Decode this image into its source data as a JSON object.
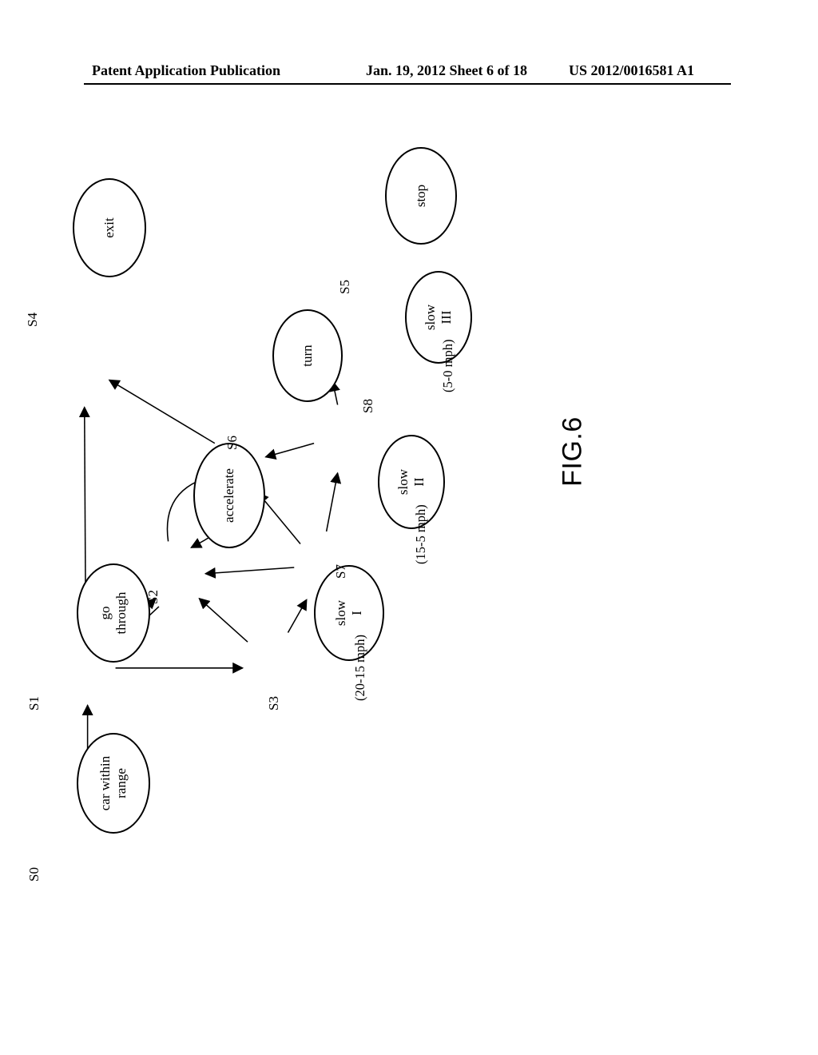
{
  "header": {
    "left": "Patent Application Publication",
    "center": "Jan. 19, 2012  Sheet 6 of 18",
    "right": "US 2012/0016581 A1"
  },
  "figure_caption": "FIG.6",
  "nodes": {
    "s0": {
      "id": "S0",
      "text1": "car within",
      "text2": "range"
    },
    "s1": {
      "id": "S1",
      "text1": "go",
      "text2": "through"
    },
    "s2": {
      "id": "S2",
      "text1": "accelerate"
    },
    "s3": {
      "id": "S3",
      "text1": "slow",
      "text2": "I",
      "sub": "(20-15 mph)"
    },
    "s4": {
      "id": "S4",
      "text1": "exit"
    },
    "s5": {
      "id": "S5",
      "text1": "stop"
    },
    "s6": {
      "id": "S6",
      "text1": "turn"
    },
    "s7": {
      "id": "S7",
      "text1": "slow",
      "text2": "II",
      "sub": "(15-5 mph)"
    },
    "s8": {
      "id": "S8",
      "text1": "slow",
      "text2": "III",
      "sub": "(5-0 mph)"
    }
  }
}
